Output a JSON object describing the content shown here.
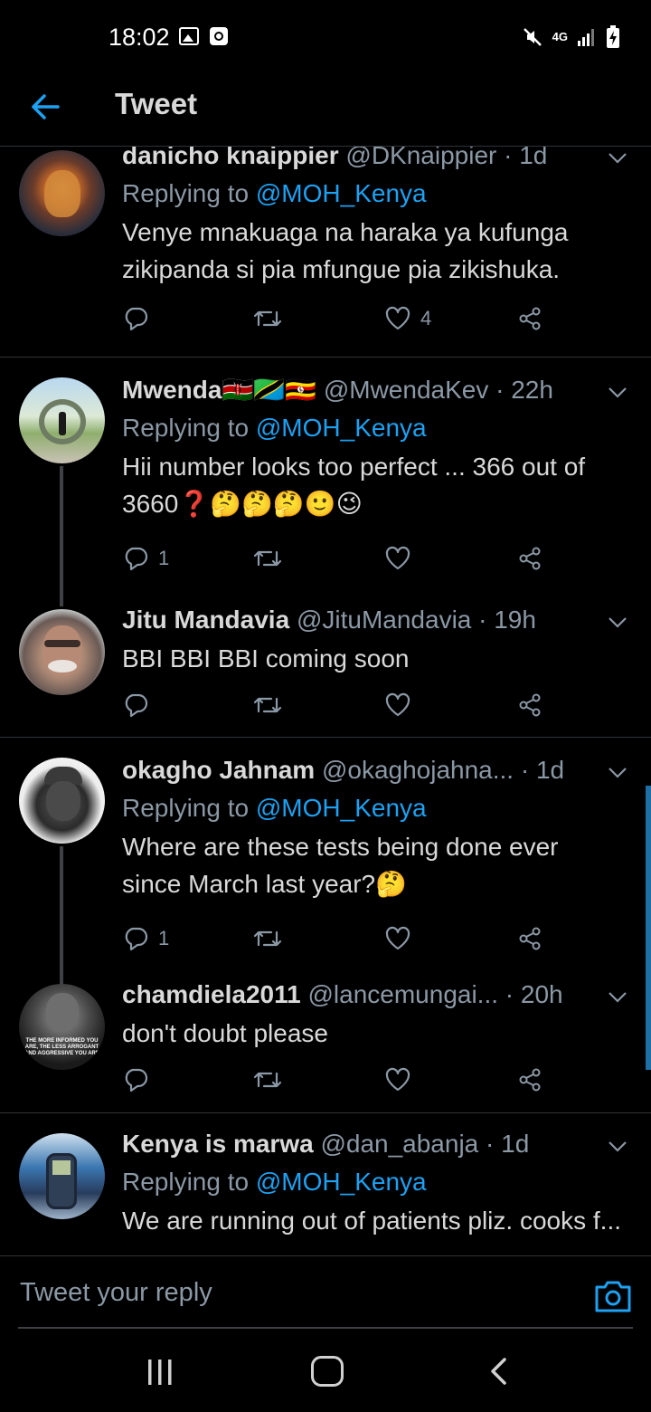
{
  "status_bar": {
    "time": "18:02",
    "network": "4G",
    "icons": [
      "gallery-icon",
      "clock-icon",
      "mute-icon",
      "signal-icon",
      "battery-icon"
    ]
  },
  "app_bar": {
    "title": "Tweet",
    "back_icon": "back-arrow-icon"
  },
  "colors": {
    "background": "#000000",
    "accent": "#1da1f2",
    "secondary_text": "#8b98a5",
    "primary_text": "#d9d9d9",
    "divider": "#2f3336"
  },
  "tweets": [
    {
      "name": "danicho knaippier",
      "meta": "@DKnaippier · 1d",
      "replying_prefix": "Replying to ",
      "replying_to": "@MOH_Kenya",
      "text": "Venye mnakuaga na haraka ya kufunga zikipanda si pia mfungue pia zikishuka.",
      "reply_count": "",
      "like_count": "4"
    },
    {
      "name": "Mwenda🇰🇪🇹🇿🇺🇬",
      "meta": "@MwendaKev · 22h",
      "replying_prefix": "Replying to ",
      "replying_to": "@MOH_Kenya",
      "text": "Hii number looks too perfect ... 366 out of 3660❓🤔🤔🤔🙂😉",
      "reply_count": "1",
      "like_count": ""
    },
    {
      "name": "Jitu Mandavia",
      "meta": "@JituMandavia · 19h",
      "text": "BBI BBI BBI coming soon",
      "reply_count": "",
      "like_count": ""
    },
    {
      "name": "okagho Jahnam",
      "meta": "@okaghojahna...  · 1d",
      "replying_prefix": "Replying to ",
      "replying_to": "@MOH_Kenya",
      "text": "Where are these tests being done ever since March last year?🤔",
      "reply_count": "1",
      "like_count": ""
    },
    {
      "name": "chamdiela2011",
      "meta": "@lancemungai...  · 20h",
      "text": "don't doubt please",
      "avatar_caption": "THE MORE INFORMED YOU ARE, THE LESS ARROGANT AND AGGRESSIVE YOU ARE",
      "reply_count": "",
      "like_count": ""
    },
    {
      "name": "Kenya is marwa",
      "meta": "@dan_abanja · 1d",
      "replying_prefix": "Replying to ",
      "replying_to": "@MOH_Kenya",
      "text": "We are running out of patients pliz. cooks f..."
    }
  ],
  "reply_bar": {
    "placeholder": "Tweet your reply",
    "camera_icon": "camera-icon"
  },
  "nav_bar": {
    "icons": [
      "recents-icon",
      "home-icon",
      "back-icon"
    ]
  }
}
